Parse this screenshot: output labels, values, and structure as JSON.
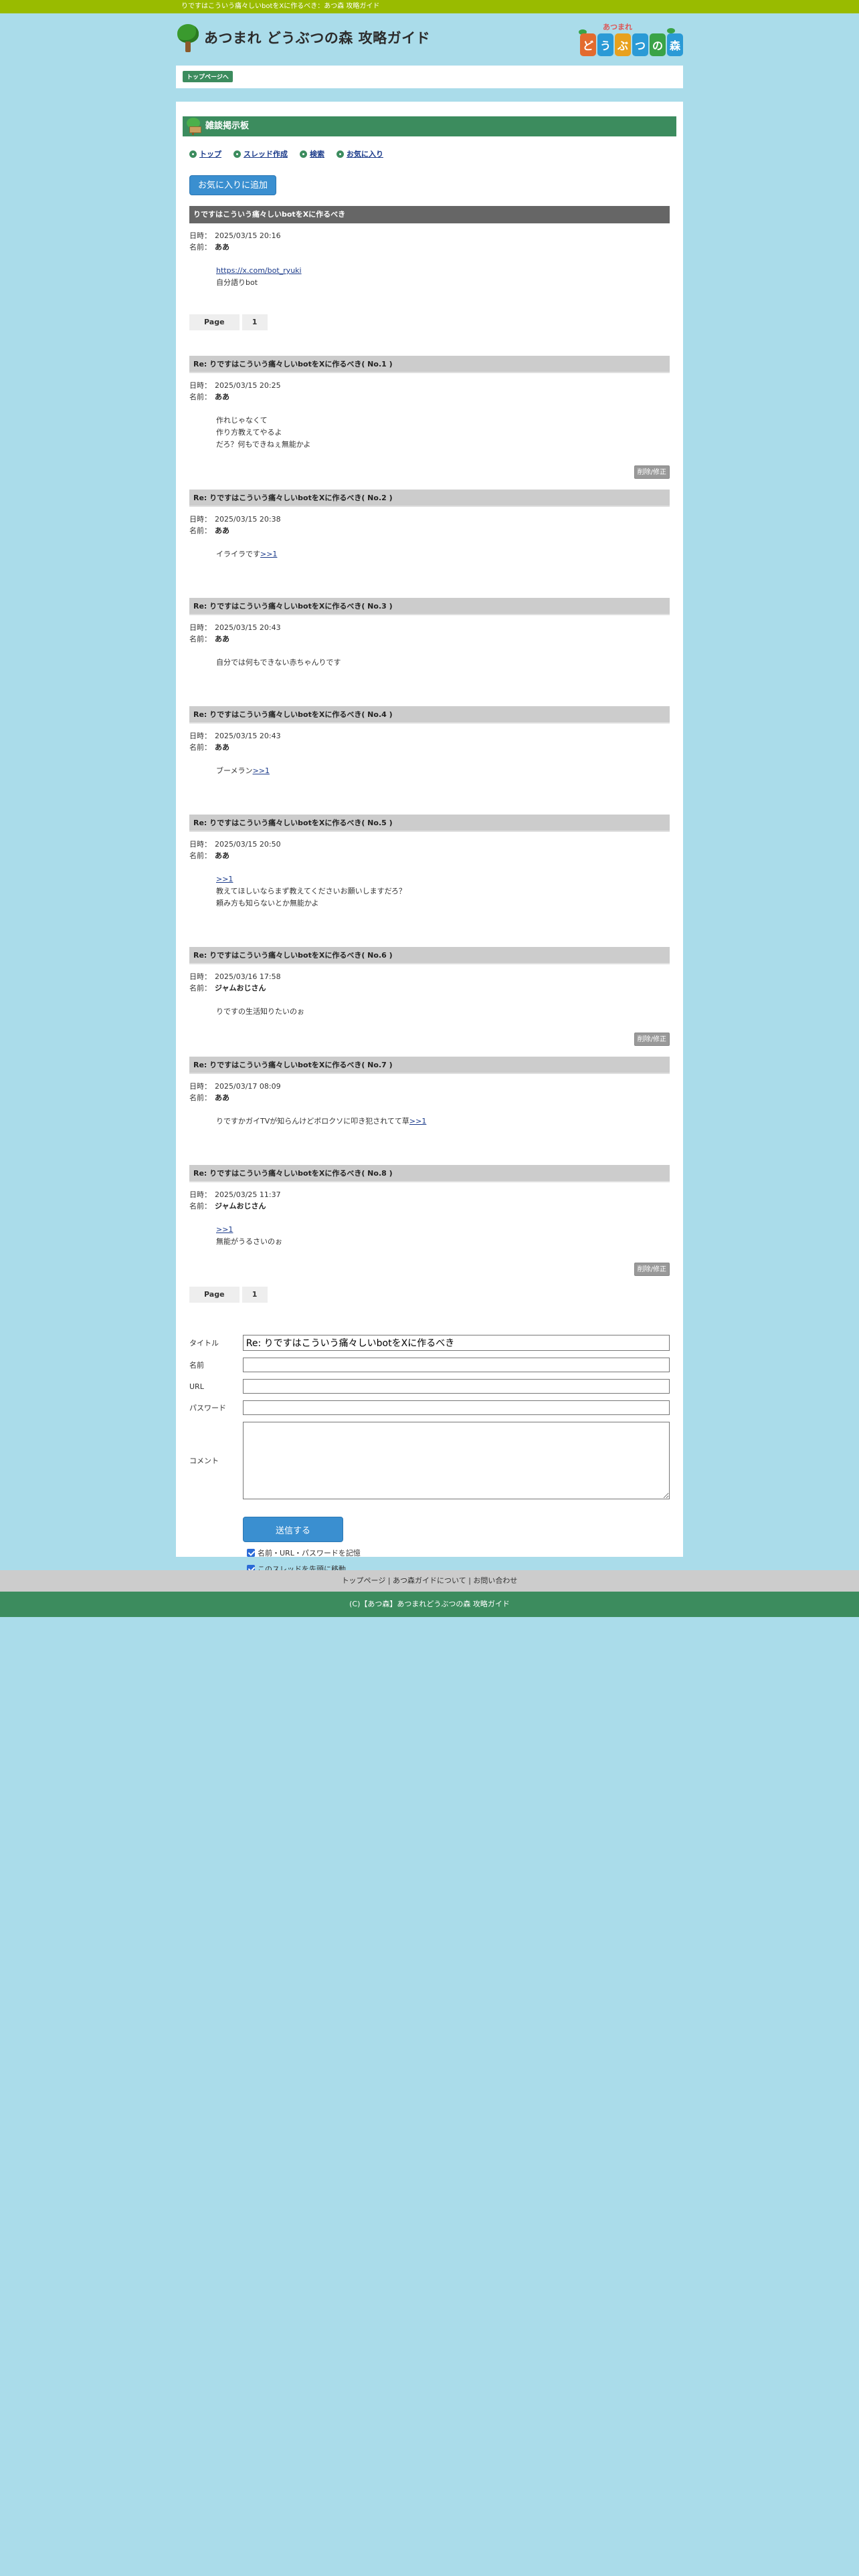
{
  "window_title": "りですはこういう痛々しいbotをXに作るべき：あつ森 攻略ガイド",
  "site": {
    "title": "あつまれ どうぶつの森 攻略ガイド",
    "logo_small": "あつまれ",
    "logo_tiles": [
      "ど",
      "う",
      "ぶ",
      "つ",
      "の",
      "森"
    ]
  },
  "breadcrumb": {
    "top": "トップページへ"
  },
  "board": {
    "title": "雑談掲示板"
  },
  "subnav": [
    "トップ",
    "スレッド作成",
    "検索",
    "お気に入り"
  ],
  "fav_button": "お気に入りに追加",
  "labels": {
    "date": "日時：",
    "name": "名前：",
    "delete": "削除/修正"
  },
  "thread": {
    "title": "りですはこういう痛々しいbotをXに作るべき",
    "date": "2025/03/15 20:16",
    "author": "ああ",
    "lines": [
      "https://x.com/bot_ryuki",
      "自分語りbot"
    ]
  },
  "pager": {
    "label": "Page",
    "page": "1"
  },
  "replies": [
    {
      "head": "Re: りですはこういう痛々しいbotをXに作るべき( No.1 )",
      "date": "2025/03/15 20:25",
      "author": "ああ",
      "lines": [
        "作れじゃなくて",
        "作り方教えてやるよ",
        "だろ？何もできねぇ無能かよ"
      ],
      "deletable": true
    },
    {
      "head": "Re: りですはこういう痛々しいbotをXに作るべき( No.2 )",
      "date": "2025/03/15 20:38",
      "author": "ああ",
      "lines": [
        "イライラです>>1"
      ],
      "deletable": false
    },
    {
      "head": "Re: りですはこういう痛々しいbotをXに作るべき( No.3 )",
      "date": "2025/03/15 20:43",
      "author": "ああ",
      "lines": [
        "自分では何もできない赤ちゃんりです"
      ],
      "deletable": false
    },
    {
      "head": "Re: りですはこういう痛々しいbotをXに作るべき( No.4 )",
      "date": "2025/03/15 20:43",
      "author": "ああ",
      "lines": [
        "ブーメラン>>1"
      ],
      "deletable": false
    },
    {
      "head": "Re: りですはこういう痛々しいbotをXに作るべき( No.5 )",
      "date": "2025/03/15 20:50",
      "author": "ああ",
      "lines": [
        ">>1",
        "教えてほしいならまず教えてくださいお願いしますだろ？",
        "頼み方も知らないとか無能かよ"
      ],
      "deletable": false
    },
    {
      "head": "Re: りですはこういう痛々しいbotをXに作るべき( No.6 )",
      "date": "2025/03/16 17:58",
      "author": "ジャムおじさん",
      "lines": [
        "りですの生活知りたいのぉ"
      ],
      "deletable": true
    },
    {
      "head": "Re: りですはこういう痛々しいbotをXに作るべき( No.7 )",
      "date": "2025/03/17 08:09",
      "author": "ああ",
      "lines": [
        "りですかガイTVが知らんけどボロクソに叩き犯されてて草>>1"
      ],
      "deletable": false
    },
    {
      "head": "Re: りですはこういう痛々しいbotをXに作るべき( No.8 )",
      "date": "2025/03/25 11:37",
      "author": "ジャムおじさん",
      "lines": [
        ">>1",
        "無能がうるさいのぉ"
      ],
      "deletable": true
    }
  ],
  "form": {
    "title_label": "タイトル",
    "title_value": "Re: りですはこういう痛々しいbotをXに作るべき",
    "name_label": "名前",
    "url_label": "URL",
    "password_label": "パスワード",
    "comment_label": "コメント",
    "submit": "送信する",
    "remember": "名前・URL・パスワードを記憶",
    "move_top": "このスレッドを先頭に移動"
  },
  "footer": {
    "links": "トップページ | あつ森ガイドについて | お問い合わせ",
    "copyright": "(C)【あつ森】あつまれどうぶつの森 攻略ガイド"
  },
  "colors": {
    "accent": "#3c8c5e",
    "topbar": "#99bb00",
    "background": "#aadcea",
    "button": "#3a8fd0"
  }
}
